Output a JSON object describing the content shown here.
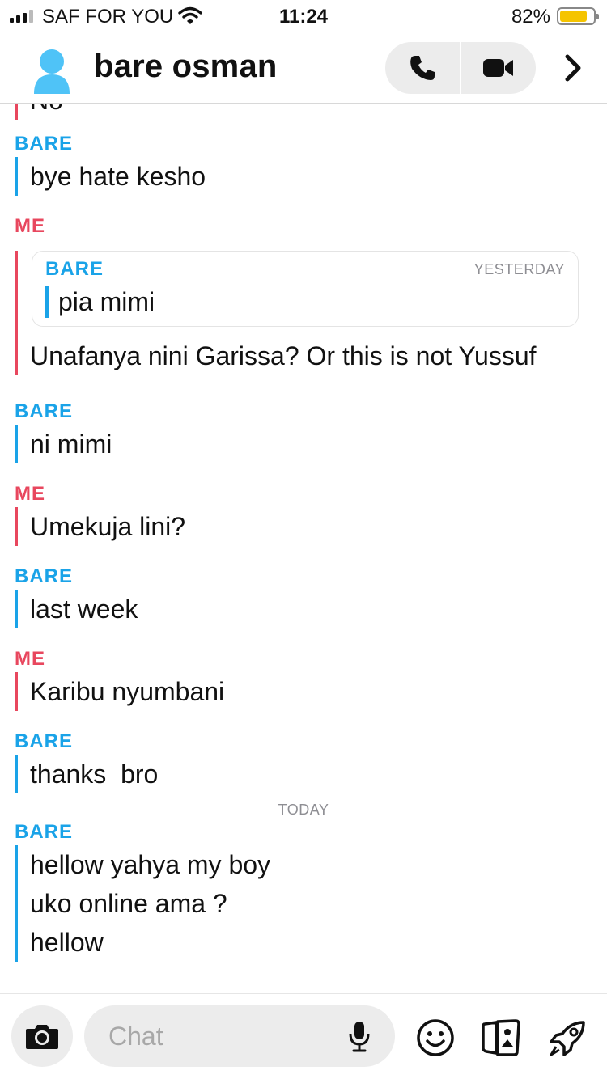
{
  "status_bar": {
    "carrier": "SAF FOR YOU",
    "time": "11:24",
    "battery_percent": "82%",
    "battery_level": 0.82,
    "battery_color": "#f5c400"
  },
  "header": {
    "contact_name": "bare osman",
    "avatar_icon": "person-silhouette-icon",
    "avatar_color": "#4fc3f7",
    "call_icon": "phone-icon",
    "video_icon": "video-camera-icon",
    "more_icon": "chevron-right-icon"
  },
  "colors": {
    "bare": "#1aa3e8",
    "me": "#e8475e"
  },
  "messages": [
    {
      "sender": "",
      "lines": [
        "No"
      ]
    },
    {
      "sender": "BARE",
      "lines": [
        "bye hate kesho"
      ]
    },
    {
      "sender": "ME",
      "quote": {
        "sender": "BARE",
        "date": "YESTERDAY",
        "text": "pia mimi"
      },
      "lines": [
        "Unafanya nini Garissa? Or this is not Yussuf"
      ]
    },
    {
      "sender": "BARE",
      "lines": [
        "ni mimi"
      ]
    },
    {
      "sender": "ME",
      "lines": [
        "Umekuja lini?"
      ]
    },
    {
      "sender": "BARE",
      "lines": [
        "last week"
      ]
    },
    {
      "sender": "ME",
      "lines": [
        "Karibu nyumbani"
      ]
    },
    {
      "sender": "BARE",
      "lines": [
        "thanks  bro"
      ]
    },
    {
      "separator": "TODAY"
    },
    {
      "sender": "BARE",
      "lines": [
        "hellow yahya my boy",
        "uko online ama ?",
        "hellow"
      ]
    }
  ],
  "composer": {
    "placeholder": "Chat",
    "camera_icon": "camera-icon",
    "mic_icon": "microphone-icon",
    "tools": [
      "smiley-icon",
      "stickers-icon",
      "rocket-icon"
    ]
  }
}
